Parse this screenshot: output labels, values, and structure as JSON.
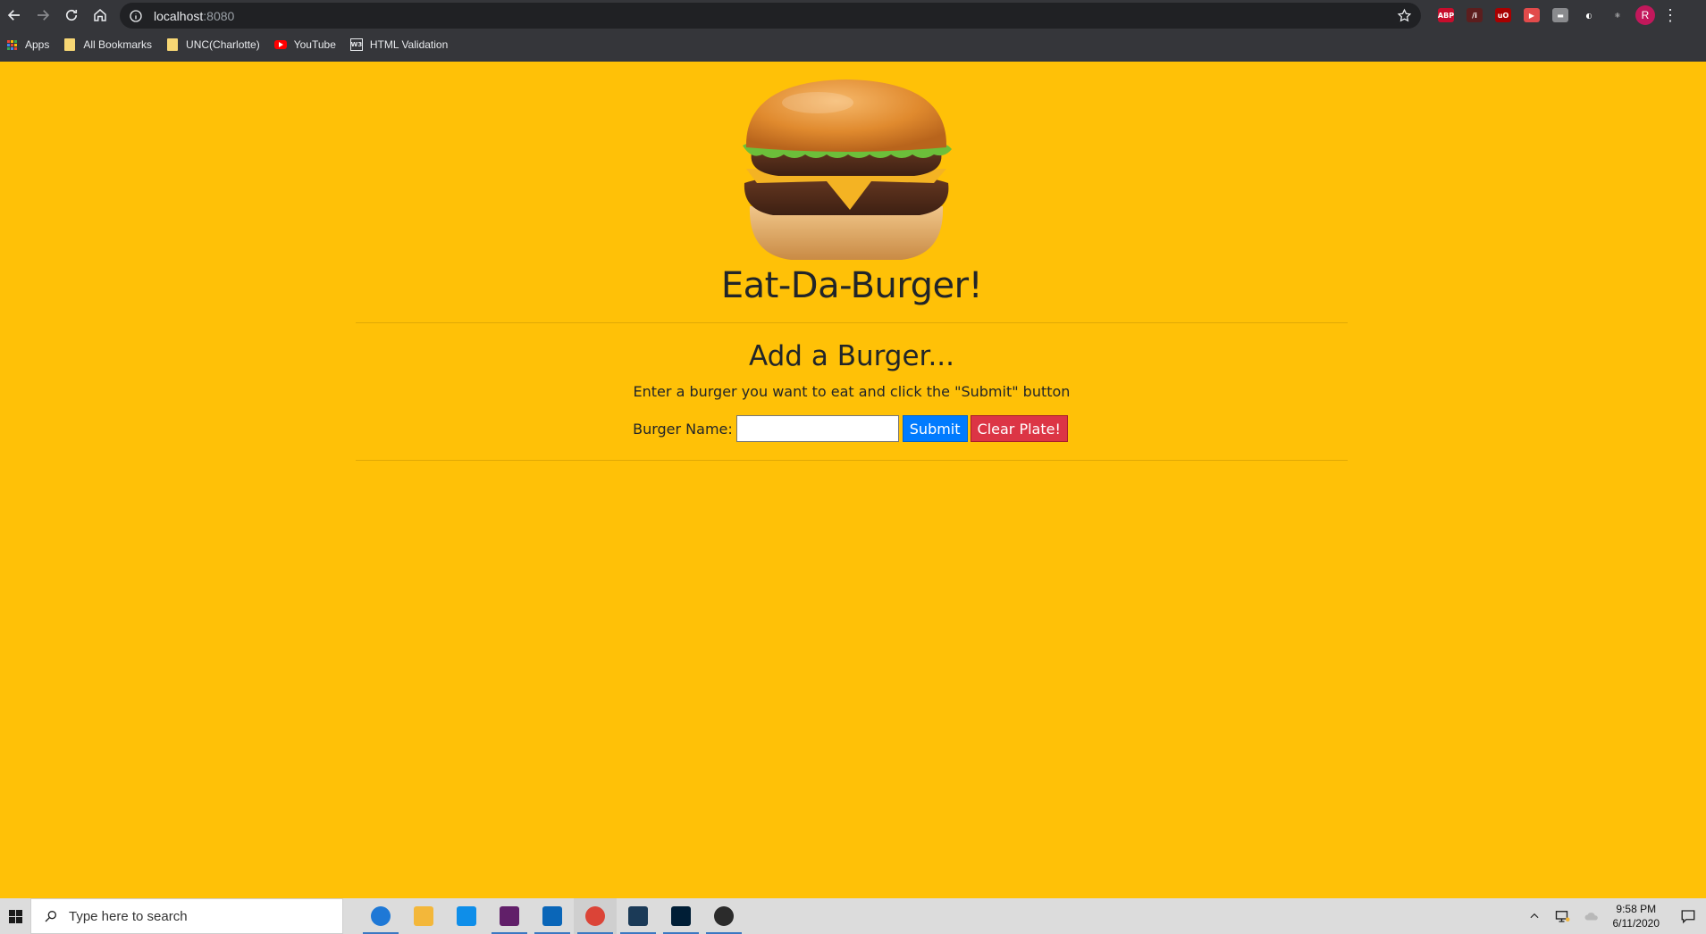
{
  "browser": {
    "url_host": "localhost",
    "url_port": ":8080",
    "bookmarks": [
      {
        "label": "Apps",
        "icon": "apps-grid-icon"
      },
      {
        "label": "All Bookmarks",
        "icon": "folder-icon"
      },
      {
        "label": "UNC(Charlotte)",
        "icon": "folder-icon"
      },
      {
        "label": "YouTube",
        "icon": "youtube-icon"
      },
      {
        "label": "HTML Validation",
        "icon": "w3c-icon"
      }
    ],
    "extensions": [
      {
        "name": "adblock-plus-icon",
        "text": "ABP",
        "color": "#c70d2c"
      },
      {
        "name": "extension-red-icon",
        "text": "/i",
        "color": "#5c1e1e"
      },
      {
        "name": "ublock-origin-icon",
        "text": "uO",
        "color": "#a80000"
      },
      {
        "name": "screen-recorder-icon",
        "text": "▶",
        "color": "#e24b4b"
      },
      {
        "name": "extension-print-icon",
        "text": "▬",
        "color": "#8a8b8e"
      },
      {
        "name": "extension-circle-icon",
        "text": "◐",
        "color": "#35363a"
      },
      {
        "name": "react-devtools-icon",
        "text": "⚛",
        "color": "#35363a"
      }
    ],
    "profile_initial": "R"
  },
  "page": {
    "title": "Eat-Da-Burger!",
    "subtitle": "Add a Burger...",
    "instructions": "Enter a burger you want to eat and click the \"Submit\" button",
    "form": {
      "label": "Burger Name:",
      "input_value": "",
      "submit_label": "Submit",
      "clear_label": "Clear Plate!"
    }
  },
  "taskbar": {
    "search_placeholder": "Type here to search",
    "time": "9:58 PM",
    "date": "6/11/2020",
    "apps": [
      {
        "name": "taskbar-app-browser-icon",
        "color": "#1e78d6"
      },
      {
        "name": "taskbar-file-explorer-icon",
        "color": "#f3b73a"
      },
      {
        "name": "taskbar-teamviewer-icon",
        "color": "#0e8ee9"
      },
      {
        "name": "taskbar-slack-icon",
        "color": "#611f69"
      },
      {
        "name": "taskbar-vscode-icon",
        "color": "#0a66b8"
      },
      {
        "name": "taskbar-chrome-icon",
        "color": "#db4437"
      },
      {
        "name": "taskbar-mysql-workbench-icon",
        "color": "#1b3a57"
      },
      {
        "name": "taskbar-photoshop-icon",
        "color": "#001e36"
      },
      {
        "name": "taskbar-app-mountain-icon",
        "color": "#2b2b2b"
      }
    ]
  },
  "colors": {
    "page_background": "#ffc107",
    "submit_button": "#007bff",
    "clear_button": "#dc3545"
  }
}
